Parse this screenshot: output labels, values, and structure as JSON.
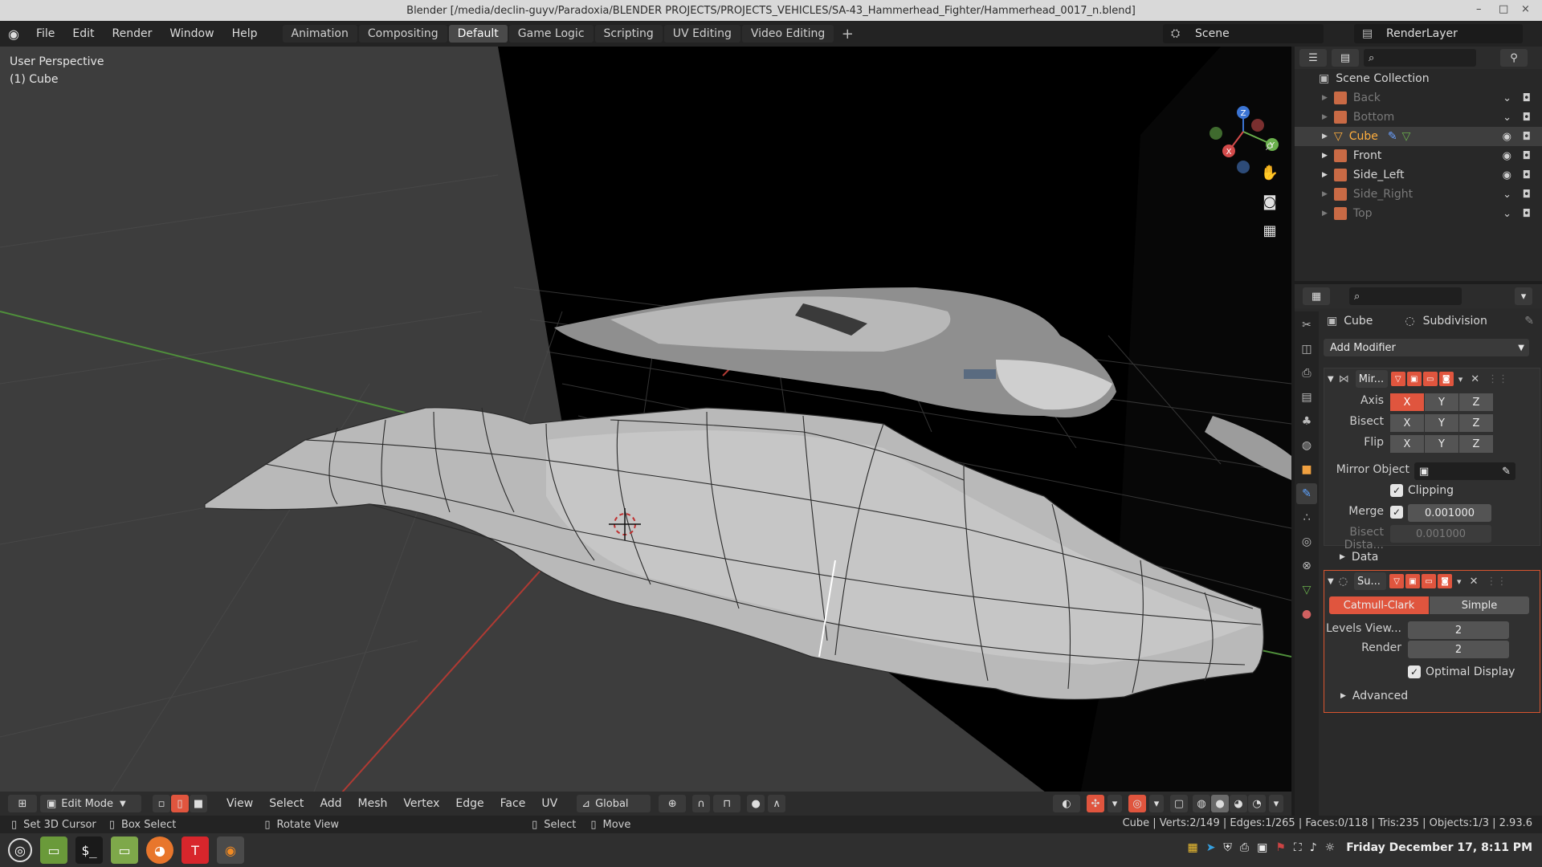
{
  "window": {
    "title": "Blender [/media/declin-guyv/Paradoxia/BLENDER PROJECTS/PROJECTS_VEHICLES/SA-43_Hammerhead_Fighter/Hammerhead_0017_n.blend]",
    "minimize": "–",
    "maximize": "□",
    "close": "×"
  },
  "menubar": {
    "items": [
      "File",
      "Edit",
      "Render",
      "Window",
      "Help"
    ],
    "workspaces": [
      "Animation",
      "Compositing",
      "Default",
      "Game Logic",
      "Scripting",
      "UV Editing",
      "Video Editing"
    ],
    "active_workspace": "Default",
    "add_tab": "+",
    "scene": "Scene",
    "render_layer": "RenderLayer"
  },
  "viewport": {
    "perspective": "User Perspective",
    "object": "(1) Cube",
    "gizmo": {
      "x": "X",
      "y": "Y",
      "z": "Z"
    }
  },
  "viewport_header": {
    "mode": "Edit Mode",
    "menus": [
      "View",
      "Select",
      "Add",
      "Mesh",
      "Vertex",
      "Edge",
      "Face",
      "UV"
    ],
    "orientation": "Global"
  },
  "statusbar": {
    "left": [
      {
        "icon": "mouse-left-icon",
        "label": "Set 3D Cursor"
      },
      {
        "icon": "mouse-drag-icon",
        "label": "Box Select"
      },
      {
        "icon": "mouse-middle-icon",
        "label": "Rotate View"
      },
      {
        "icon": "mouse-left-icon",
        "label": "Select"
      },
      {
        "icon": "mouse-drag-icon",
        "label": "Move"
      }
    ],
    "right": "Cube | Verts:2/149 | Edges:1/265 | Faces:0/118 | Tris:235 | Objects:1/3 | 2.93.6"
  },
  "outliner": {
    "root": "Scene Collection",
    "items": [
      {
        "name": "Back",
        "state": "dim"
      },
      {
        "name": "Bottom",
        "state": "dim"
      },
      {
        "name": "Cube",
        "state": "selected"
      },
      {
        "name": "Front",
        "state": "normal"
      },
      {
        "name": "Side_Left",
        "state": "normal"
      },
      {
        "name": "Side_Right",
        "state": "dim"
      },
      {
        "name": "Top",
        "state": "dim"
      }
    ]
  },
  "properties": {
    "object_name": "Cube",
    "modifier_name": "Subdivision",
    "add_modifier": "Add Modifier",
    "mirror": {
      "name": "Mir...",
      "axis_label": "Axis",
      "bisect_label": "Bisect",
      "flip_label": "Flip",
      "axes": [
        "X",
        "Y",
        "Z"
      ],
      "mirror_object_label": "Mirror Object",
      "clipping_label": "Clipping",
      "merge_label": "Merge",
      "merge_value": "0.001000",
      "bisect_distance_label": "Bisect Dista...",
      "bisect_distance_value": "0.001000",
      "data_label": "Data"
    },
    "subdivision": {
      "name": "Su...",
      "catmull": "Catmull-Clark",
      "simple": "Simple",
      "levels_label": "Levels View...",
      "levels_value": "2",
      "render_label": "Render",
      "render_value": "2",
      "optimal_label": "Optimal Display",
      "advanced_label": "Advanced"
    }
  },
  "taskbar": {
    "clock": "Friday December 17, 8:11 PM"
  },
  "colors": {
    "accent": "#e0553e",
    "selected_text": "#ffae3d",
    "viewport_bg": "#3d3d3d"
  }
}
